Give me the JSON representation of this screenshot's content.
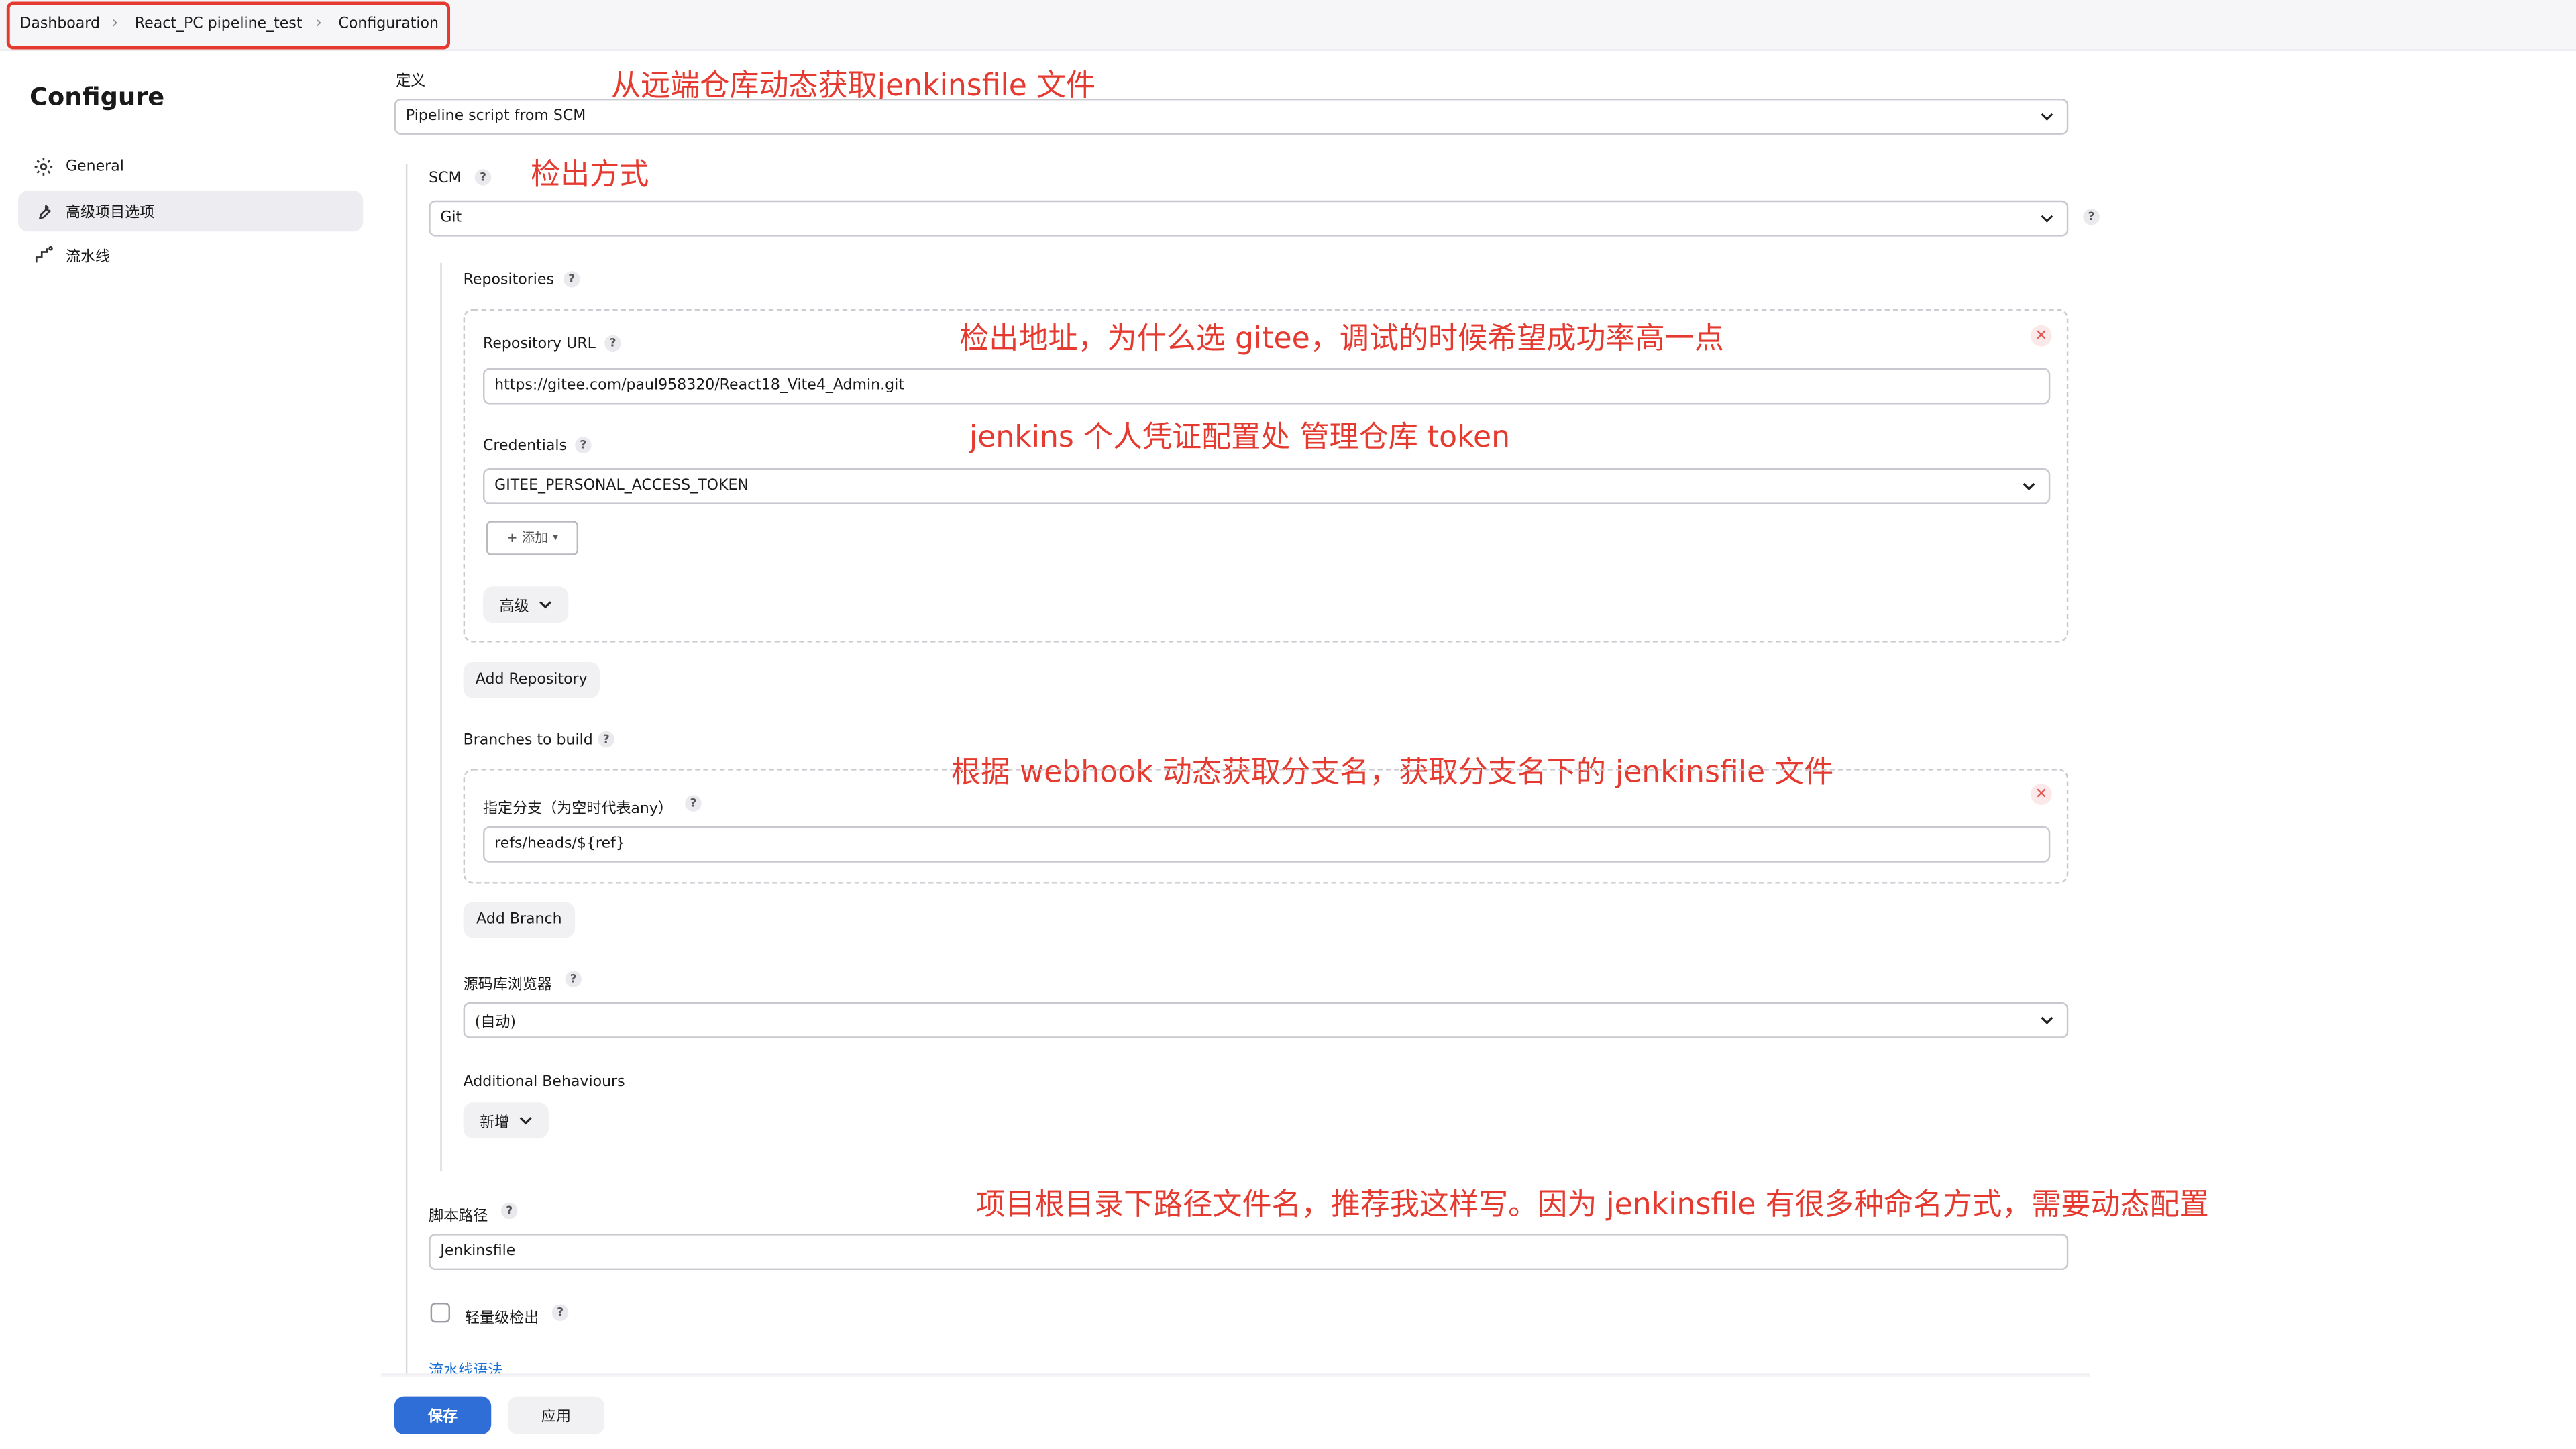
{
  "breadcrumb": [
    "Dashboard",
    "React_PC pipeline_test",
    "Configuration"
  ],
  "sidebar": {
    "title": "Configure",
    "items": [
      {
        "label": "General",
        "icon": "gear-icon",
        "active": false
      },
      {
        "label": "高级项目选项",
        "icon": "wrench-icon",
        "active": true
      },
      {
        "label": "流水线",
        "icon": "pipeline-icon",
        "active": false
      }
    ]
  },
  "definition": {
    "label": "定义",
    "value": "Pipeline script from SCM"
  },
  "scm": {
    "label": "SCM",
    "value": "Git"
  },
  "repositories": {
    "label": "Repositories",
    "repo_url_label": "Repository URL",
    "repo_url_value": "https://gitee.com/paul958320/React18_Vite4_Admin.git",
    "credentials_label": "Credentials",
    "credentials_value": "GITEE_PERSONAL_ACCESS_TOKEN",
    "add_credential_label": "+ 添加",
    "advanced_label": "高级",
    "add_repository_label": "Add Repository"
  },
  "branches": {
    "label": "Branches to build",
    "specifier_label": "指定分支（为空时代表any）",
    "specifier_value": "refs/heads/${ref}",
    "add_branch_label": "Add Branch"
  },
  "browser": {
    "label": "源码库浏览器",
    "value": "(自动)"
  },
  "behaviours": {
    "label": "Additional Behaviours",
    "add_label": "新增"
  },
  "script_path": {
    "label": "脚本路径",
    "value": "Jenkinsfile"
  },
  "lightweight": {
    "label": "轻量级检出",
    "checked": false
  },
  "pipeline_syntax_link": "流水线语法",
  "buttons": {
    "save": "保存",
    "apply": "应用"
  },
  "annotations": {
    "definition": "从远端仓库动态获取jenkinsfile 文件",
    "scm": "检出方式",
    "repo_url": "检出地址，为什么选 gitee，调试的时候希望成功率高一点",
    "credentials": "jenkins 个人凭证配置处 管理仓库 token",
    "branch": "根据 webhook 动态获取分支名，获取分支名下的 jenkinsfile 文件",
    "script_path": "项目根目录下路径文件名，推荐我这样写。因为 jenkinsfile 有很多种命名方式，需要动态配置"
  },
  "colors": {
    "annotation": "#e53a2f",
    "primary": "#2e6ed6",
    "link": "#1a6fd6"
  }
}
